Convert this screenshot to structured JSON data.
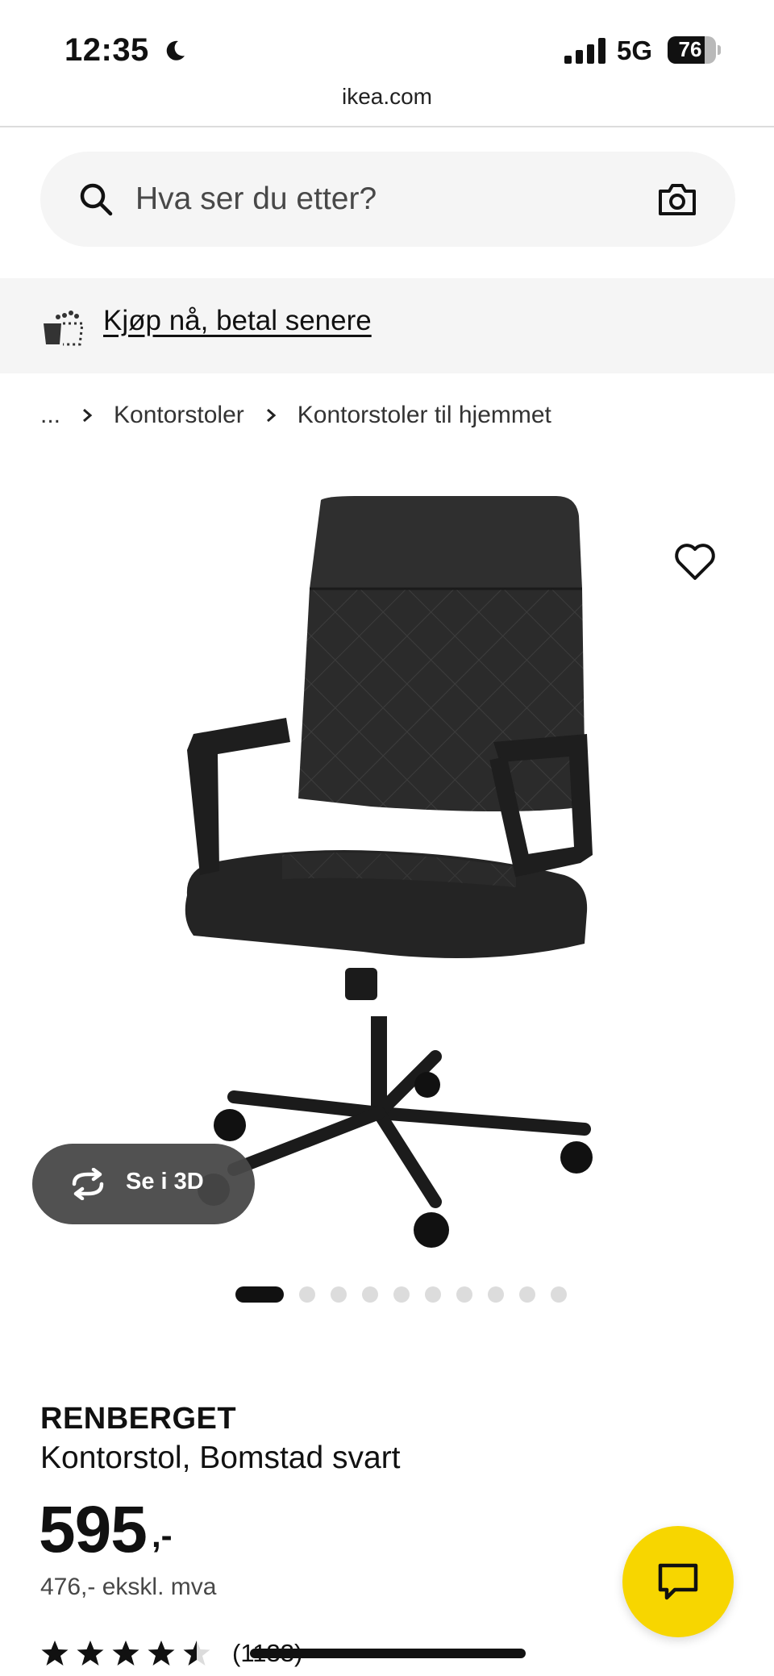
{
  "status_bar": {
    "time": "12:35",
    "network": "5G",
    "battery": "76",
    "battery_level": 0.76
  },
  "browser": {
    "url": "ikea.com"
  },
  "search": {
    "placeholder": "Hva ser du etter?"
  },
  "promo": {
    "text": "Kjøp nå, betal senere"
  },
  "breadcrumb": {
    "items": [
      "...",
      "Kontorstoler",
      "Kontorstoler til hjemmet"
    ]
  },
  "gallery": {
    "view_3d_label": "Se i 3D",
    "image_count": 10,
    "active_index": 0
  },
  "product": {
    "name": "RENBERGET",
    "description": "Kontorstol, Bomstad svart",
    "price": "595",
    "price_suffix": ",-",
    "price_ex_vat": "476,- ekskl. mva",
    "rating": 4.5,
    "review_count": "(1133)"
  },
  "icons": {
    "moon": "moon-icon",
    "signal": "signal-icon",
    "search": "search-icon",
    "camera": "camera-icon",
    "bag": "shopping-bag-icon",
    "heart": "heart-icon",
    "rotate": "rotate-3d-icon",
    "chat": "chat-icon",
    "star": "star-icon"
  },
  "colors": {
    "chat_button": "#f7d600",
    "view_3d_background": "#484848",
    "promo_background": "#f5f5f5"
  }
}
